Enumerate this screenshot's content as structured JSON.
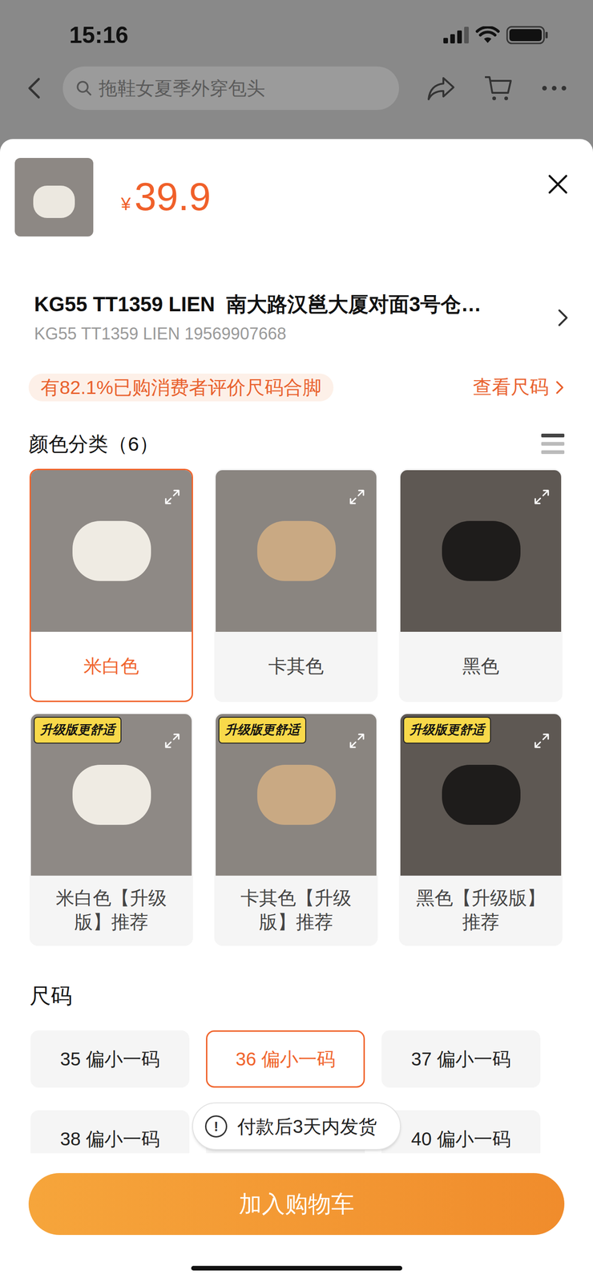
{
  "status_bar": {
    "time": "15:16"
  },
  "header": {
    "search_placeholder": "拖鞋女夏季外穿包头"
  },
  "product": {
    "price_symbol": "¥",
    "price": "39.9"
  },
  "shop": {
    "title": "KG55 TT1359 LIEN  南大路汉邕大厦对面3号仓…",
    "subtitle": "KG55 TT1359 LIEN 19569907668"
  },
  "fit_banner": {
    "text": "有82.1%已购消费者评价尺码合脚",
    "link": "查看尺码"
  },
  "colors": {
    "title": "颜色分类（6）",
    "items": [
      {
        "label": "米白色",
        "selected": true,
        "badge": null
      },
      {
        "label": "卡其色",
        "selected": false,
        "badge": null
      },
      {
        "label": "黑色",
        "selected": false,
        "badge": null
      },
      {
        "label": "米白色【升级版】推荐",
        "selected": false,
        "badge": "升级版更舒适"
      },
      {
        "label": "卡其色【升级版】推荐",
        "selected": false,
        "badge": "升级版更舒适"
      },
      {
        "label": "黑色【升级版】推荐",
        "selected": false,
        "badge": "升级版更舒适"
      }
    ]
  },
  "sizes": {
    "title": "尺码",
    "items": [
      {
        "label": "35 偏小一码",
        "selected": false
      },
      {
        "label": "36 偏小一码",
        "selected": true
      },
      {
        "label": "37 偏小一码",
        "selected": false
      },
      {
        "label": "38 偏小一码",
        "selected": false
      },
      {
        "label": null,
        "selected": false
      },
      {
        "label": "40 偏小一码",
        "selected": false
      }
    ]
  },
  "toast": {
    "icon": "!",
    "text": "付款后3天内发货"
  },
  "button": {
    "label": "加入购物车"
  }
}
